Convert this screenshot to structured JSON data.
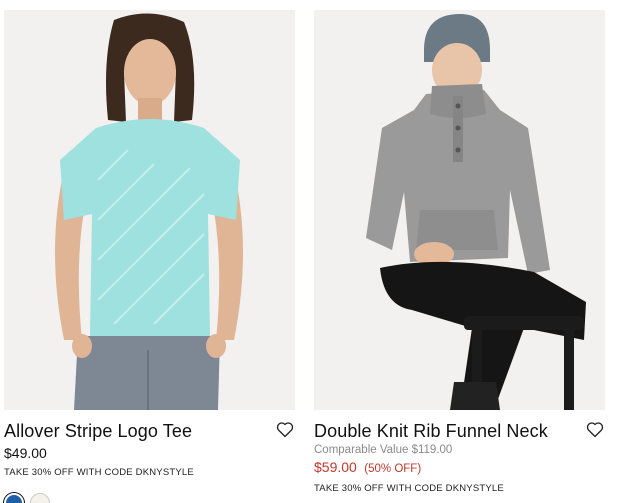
{
  "products": [
    {
      "name": "Allover Stripe Logo Tee",
      "price": "$49.00",
      "promo": "TAKE 30% OFF WITH CODE DKNYSTYLE"
    },
    {
      "name": "Double Knit Rib Funnel Neck",
      "comparable": "Comparable Value $119.00",
      "sale_price": "$59.00",
      "discount": "(50% OFF)",
      "promo": "TAKE 30% OFF WITH CODE DKNYSTYLE"
    }
  ],
  "icons": {
    "wishlist": "heart-outline-icon"
  },
  "colors": {
    "sale": "#c0392b",
    "swatch_selected": "#1f5fa8",
    "swatch_alt": "#f3f1ea",
    "tee": "#9ee1df",
    "sweater": "#9a9a9a"
  }
}
